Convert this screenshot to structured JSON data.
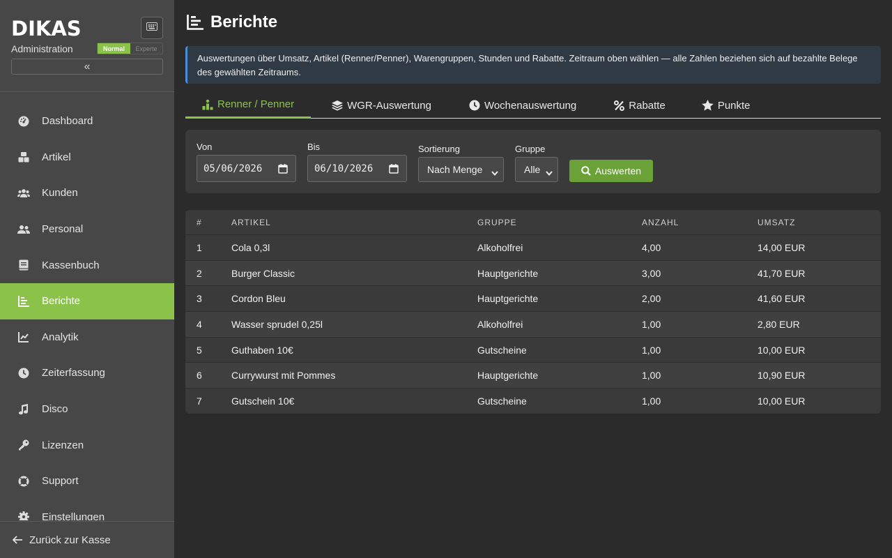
{
  "sidebar": {
    "logo": "DIKAS",
    "subtitle": "Administration",
    "mode_normal": "Normal",
    "mode_expert": "Experte",
    "collapse_glyph": "«",
    "items": [
      {
        "label": "Dashboard",
        "icon": "gauge-icon"
      },
      {
        "label": "Artikel",
        "icon": "boxes-icon"
      },
      {
        "label": "Kunden",
        "icon": "users-icon"
      },
      {
        "label": "Personal",
        "icon": "user-group-icon"
      },
      {
        "label": "Kassenbuch",
        "icon": "book-icon"
      },
      {
        "label": "Berichte",
        "icon": "chart-bar-icon",
        "active": true
      },
      {
        "label": "Analytik",
        "icon": "chart-line-icon"
      },
      {
        "label": "Zeiterfassung",
        "icon": "clock-icon"
      },
      {
        "label": "Disco",
        "icon": "music-icon"
      },
      {
        "label": "Lizenzen",
        "icon": "key-icon"
      },
      {
        "label": "Support",
        "icon": "life-ring-icon"
      },
      {
        "label": "Einstellungen",
        "icon": "gear-icon"
      }
    ],
    "back_label": "Zurück zur Kasse"
  },
  "header": {
    "title": "Berichte"
  },
  "info": {
    "text": "Auswertungen über Umsatz, Artikel (Renner/Penner), Warengruppen, Stunden und Rabatte. Zeitraum oben wählen — alle Zahlen beziehen sich auf bezahlte Belege des gewählten Zeitraums."
  },
  "tabs": [
    {
      "label": "Renner / Penner",
      "icon": "ranking-icon",
      "active": true
    },
    {
      "label": "WGR-Auswertung",
      "icon": "layers-icon"
    },
    {
      "label": "Wochenauswertung",
      "icon": "clock-icon"
    },
    {
      "label": "Rabatte",
      "icon": "percent-icon"
    },
    {
      "label": "Punkte",
      "icon": "star-icon"
    }
  ],
  "filters": {
    "von_label": "Von",
    "von_value": "05/06/2026",
    "bis_label": "Bis",
    "bis_value": "06/10/2026",
    "sort_label": "Sortierung",
    "sort_value": "Nach Menge",
    "group_label": "Gruppe",
    "group_value": "Alle",
    "submit_label": "Auswerten"
  },
  "table": {
    "columns": [
      "#",
      "ARTIKEL",
      "GRUPPE",
      "ANZAHL",
      "UMSATZ"
    ],
    "rows": [
      [
        "1",
        "Cola 0,3l",
        "Alkoholfrei",
        "4,00",
        "14,00 EUR"
      ],
      [
        "2",
        "Burger Classic",
        "Hauptgerichte",
        "3,00",
        "41,70 EUR"
      ],
      [
        "3",
        "Cordon Bleu",
        "Hauptgerichte",
        "2,00",
        "41,60 EUR"
      ],
      [
        "4",
        "Wasser sprudel 0,25l",
        "Alkoholfrei",
        "1,00",
        "2,80 EUR"
      ],
      [
        "5",
        "Guthaben 10€",
        "Gutscheine",
        "1,00",
        "10,00 EUR"
      ],
      [
        "6",
        "Currywurst mit Pommes",
        "Hauptgerichte",
        "1,00",
        "10,90 EUR"
      ],
      [
        "7",
        "Gutschein 10€",
        "Gutscheine",
        "1,00",
        "10,00 EUR"
      ]
    ]
  }
}
